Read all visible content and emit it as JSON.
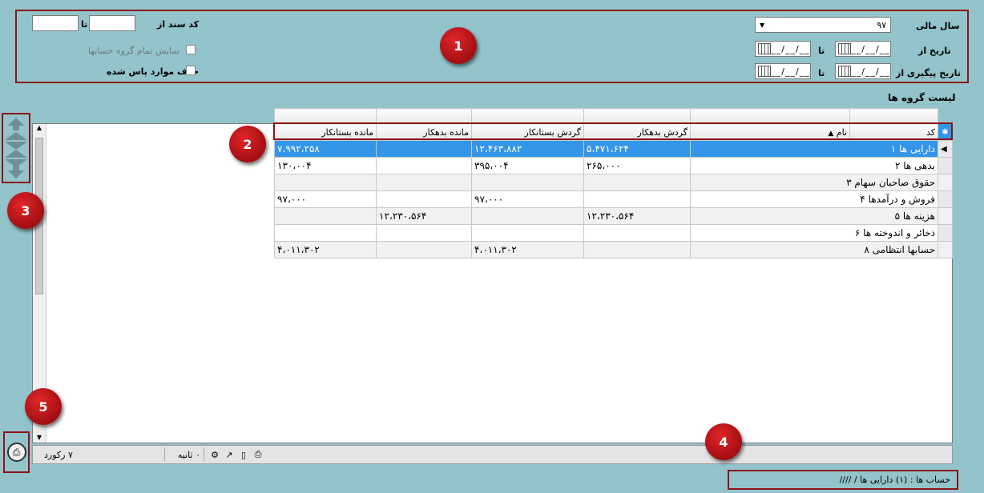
{
  "filters": {
    "doc_code_label": "کد سند از",
    "to_label": "تا",
    "show_all_groups_label": "نمایش تمام گروه حسابها",
    "remove_passed_label": "حذف موارد پاس شده",
    "fiscal_year_label": "سال مالی",
    "fiscal_year_value": "۹۷",
    "date_from_label": "تاریخ از",
    "followup_date_from_label": "تاریخ پیگیری از",
    "date_placeholder": "__/__/__"
  },
  "badges": [
    "1",
    "2",
    "3",
    "4",
    "5"
  ],
  "list_title": "لیست گروه ها",
  "columns": [
    "کد",
    "نام",
    "گردش بدهکار",
    "گردش بستانکار",
    "مانده بدهکار",
    "مانده بستانکار"
  ],
  "rows": [
    {
      "code": "۱",
      "name": "دارایی ها",
      "debit_turnover": "۵،۴۷۱،۶۲۴",
      "credit_turnover": "۱۲،۴۶۳،۸۸۲",
      "debit_balance": "",
      "credit_balance": "۷،۹۹۲،۲۵۸"
    },
    {
      "code": "۲",
      "name": "بدهی ها",
      "debit_turnover": "۲۶۵،۰۰۰",
      "credit_turnover": "۳۹۵،۰۰۴",
      "debit_balance": "",
      "credit_balance": "۱۳۰،۰۰۴"
    },
    {
      "code": "۳",
      "name": "حقوق صاحبان سهام",
      "debit_turnover": "",
      "credit_turnover": "",
      "debit_balance": "",
      "credit_balance": ""
    },
    {
      "code": "۴",
      "name": "فروش و درآمدها",
      "debit_turnover": "",
      "credit_turnover": "۹۷،۰۰۰",
      "debit_balance": "",
      "credit_balance": "۹۷،۰۰۰"
    },
    {
      "code": "۵",
      "name": "هزینه ها",
      "debit_turnover": "۱۲،۲۳۰،۵۶۴",
      "credit_turnover": "",
      "debit_balance": "۱۲،۲۳۰،۵۶۴",
      "credit_balance": ""
    },
    {
      "code": "۶",
      "name": "ذخائر و اندوخته ها",
      "debit_turnover": "",
      "credit_turnover": "",
      "debit_balance": "",
      "credit_balance": ""
    },
    {
      "code": "۸",
      "name": "حسابها انتظامی",
      "debit_turnover": "",
      "credit_turnover": "۴،۰۱۱،۳۰۲",
      "debit_balance": "",
      "credit_balance": "۴،۰۱۱،۳۰۲"
    }
  ],
  "status": {
    "records": "۷ رکورد",
    "seconds": "۰ ثانیه"
  },
  "footer": {
    "account_path": "حساب ها :   (۱) دارایی ها / ////"
  },
  "colors": {
    "background": "#93c4cb",
    "selection": "#3396e8",
    "badge": "#c3161b",
    "frame": "#8a1418"
  }
}
